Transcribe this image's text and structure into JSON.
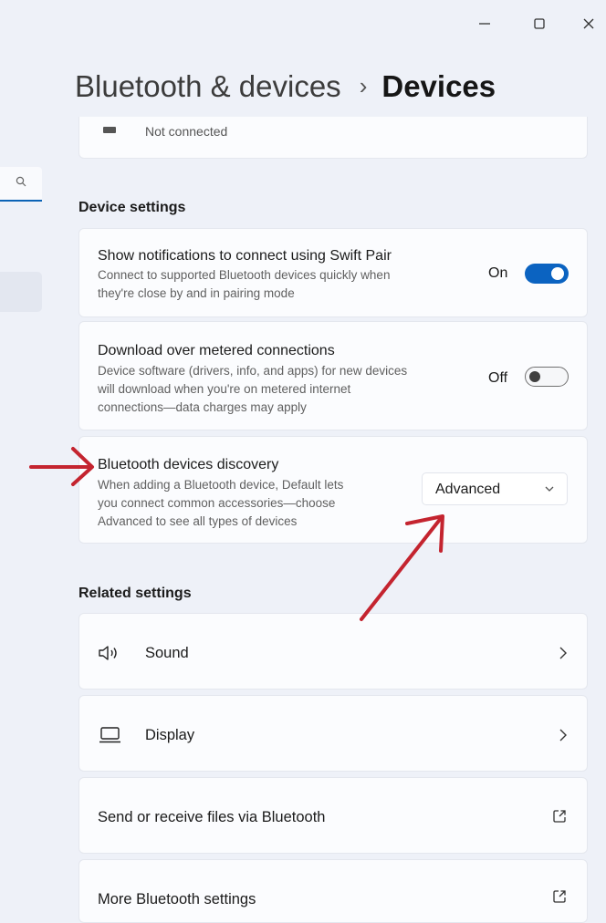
{
  "header": {
    "breadcrumb": "Bluetooth & devices",
    "separator": "›",
    "current": "Devices"
  },
  "top_device": {
    "status": "Not connected"
  },
  "device_settings": {
    "section_title": "Device settings",
    "swift_pair": {
      "title": "Show notifications to connect using Swift Pair",
      "desc_line1": "Connect to supported Bluetooth devices quickly when",
      "desc_line2": "they're close by and in pairing mode",
      "state": "On"
    },
    "metered": {
      "title": "Download over metered connections",
      "desc_line1": "Device software (drivers, info, and apps) for new devices",
      "desc_line2": "will download when you're on metered internet",
      "desc_line3": "connections—data charges may apply",
      "state": "Off"
    },
    "discovery": {
      "title": "Bluetooth devices discovery",
      "desc_line1": "When adding a Bluetooth device, Default lets",
      "desc_line2": "you connect common accessories—choose",
      "desc_line3": "Advanced to see all types of devices",
      "selected": "Advanced"
    }
  },
  "related_settings": {
    "section_title": "Related settings",
    "items": [
      {
        "label": "Sound",
        "icon": "speaker-icon",
        "trailing": "chevron-right-icon"
      },
      {
        "label": "Display",
        "icon": "monitor-icon",
        "trailing": "chevron-right-icon"
      },
      {
        "label": "Send or receive files via Bluetooth",
        "icon": "",
        "trailing": "open-external-icon"
      },
      {
        "label": "More Bluetooth settings",
        "icon": "",
        "trailing": "open-external-icon"
      }
    ]
  },
  "colors": {
    "accent": "#0b63c1",
    "annotation_arrow": "#c4242f",
    "background": "#eef1f8",
    "card": "#fbfcfe"
  }
}
